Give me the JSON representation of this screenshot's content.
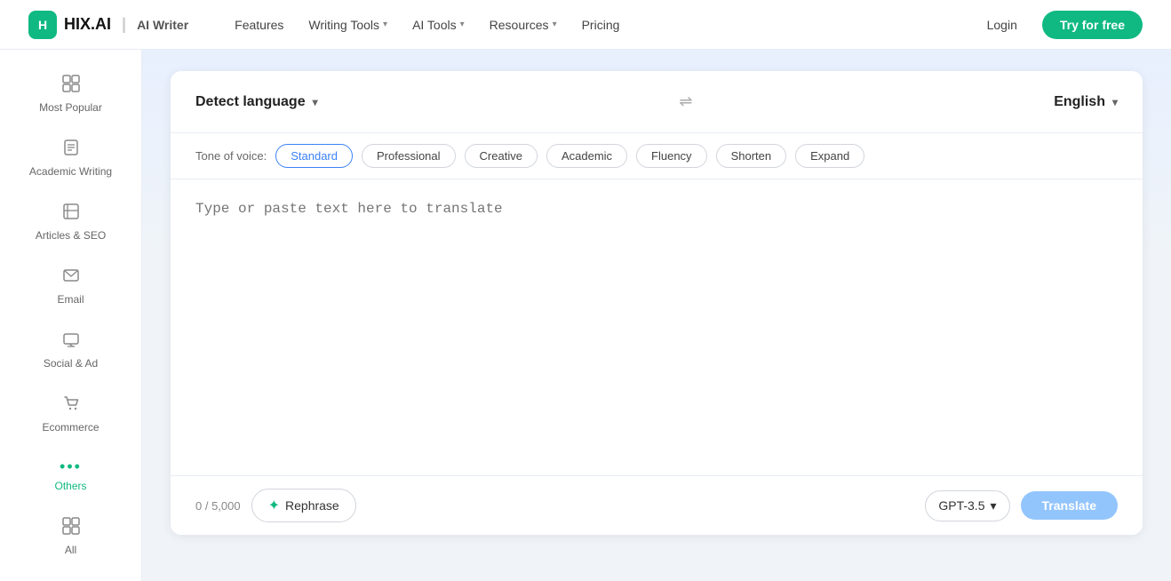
{
  "navbar": {
    "logo_text": "HIX.AI",
    "logo_subtitle": "AI Writer",
    "nav_items": [
      {
        "label": "Features",
        "has_dropdown": false
      },
      {
        "label": "Writing Tools",
        "has_dropdown": true
      },
      {
        "label": "AI Tools",
        "has_dropdown": true
      },
      {
        "label": "Resources",
        "has_dropdown": true
      },
      {
        "label": "Pricing",
        "has_dropdown": false
      }
    ],
    "login_label": "Login",
    "try_label": "Try for free"
  },
  "sidebar": {
    "items": [
      {
        "id": "most-popular",
        "label": "Most Popular",
        "icon": "⊞"
      },
      {
        "id": "academic-writing",
        "label": "Academic Writing",
        "icon": "📄"
      },
      {
        "id": "articles-seo",
        "label": "Articles & SEO",
        "icon": "▦"
      },
      {
        "id": "email",
        "label": "Email",
        "icon": "✉"
      },
      {
        "id": "social-ad",
        "label": "Social & Ad",
        "icon": "⊡"
      },
      {
        "id": "ecommerce",
        "label": "Ecommerce",
        "icon": "🛒"
      },
      {
        "id": "others",
        "label": "Others",
        "icon": "···",
        "active": true
      },
      {
        "id": "all",
        "label": "All",
        "icon": "⊞"
      }
    ]
  },
  "tool": {
    "source_lang_label": "Detect language",
    "source_lang_chevron": "▾",
    "swap_symbol": "⇌",
    "target_lang_label": "English",
    "target_lang_chevron": "▾",
    "tone_label": "Tone of voice:",
    "tones": [
      {
        "id": "standard",
        "label": "Standard",
        "active": true
      },
      {
        "id": "professional",
        "label": "Professional",
        "active": false
      },
      {
        "id": "creative",
        "label": "Creative",
        "active": false
      },
      {
        "id": "academic",
        "label": "Academic",
        "active": false
      },
      {
        "id": "fluency",
        "label": "Fluency",
        "active": false
      },
      {
        "id": "shorten",
        "label": "Shorten",
        "active": false
      },
      {
        "id": "expand",
        "label": "Expand",
        "active": false
      }
    ],
    "placeholder": "Type or paste text here to translate",
    "char_count": "0 / 5,000",
    "rephrase_label": "Rephrase",
    "gpt_label": "GPT-3.5",
    "translate_label": "Translate"
  }
}
